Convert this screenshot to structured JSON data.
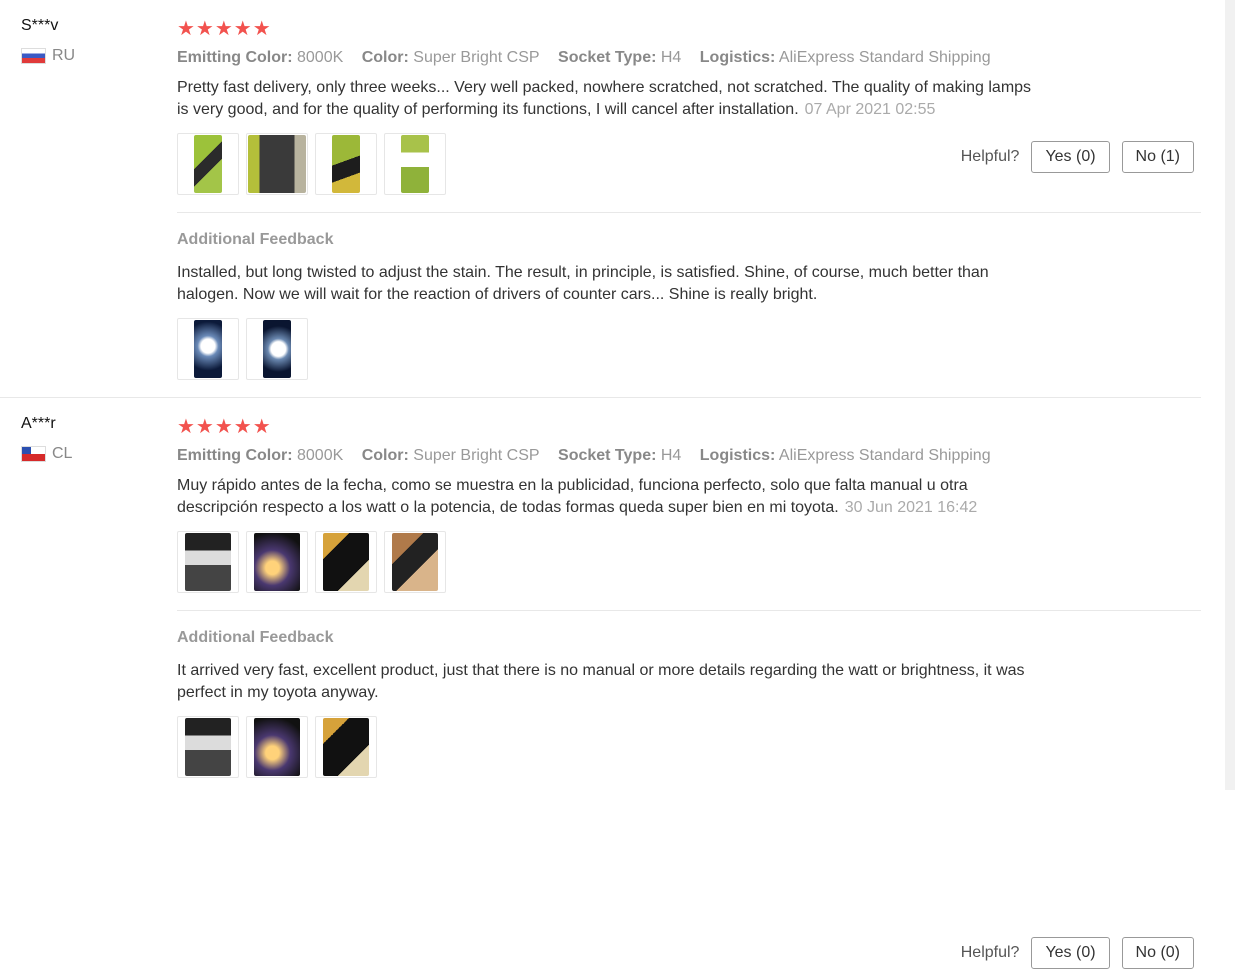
{
  "helpful_label": "Helpful?",
  "additional_feedback_title": "Additional Feedback",
  "reviews": [
    {
      "user": "S***v",
      "country": "RU",
      "stars": "★★★★★",
      "props": [
        {
          "label": "Emitting Color:",
          "value": "8000K"
        },
        {
          "label": "Color:",
          "value": "Super Bright CSP"
        },
        {
          "label": "Socket Type:",
          "value": "H4"
        },
        {
          "label": "Logistics:",
          "value": "AliExpress Standard Shipping"
        }
      ],
      "text": "Pretty fast delivery, only three weeks... Very well packed, nowhere scratched, not scratched. The quality of making lamps is very good, and for the quality of performing its functions, I will cancel after installation.",
      "date": "07 Apr 2021 02:55",
      "yes_label": "Yes (0)",
      "no_label": "No (1)",
      "additional_text": "Installed, but long twisted to adjust the stain. The result, in principle, is satisfied. Shine, of course, much better than halogen. Now we will wait for the reaction of drivers of counter cars... Shine is really bright."
    },
    {
      "user": "A***r",
      "country": "CL",
      "stars": "★★★★★",
      "props": [
        {
          "label": "Emitting Color:",
          "value": "8000K"
        },
        {
          "label": "Color:",
          "value": "Super Bright CSP"
        },
        {
          "label": "Socket Type:",
          "value": "H4"
        },
        {
          "label": "Logistics:",
          "value": "AliExpress Standard Shipping"
        }
      ],
      "text": "Muy rápido antes de la fecha, como se muestra en la publicidad, funciona perfecto, solo que falta manual u otra descripción respecto a los watt o la potencia, de todas formas queda super bien en mi toyota.",
      "date": "30 Jun 2021 16:42",
      "yes_label": "Yes (0)",
      "no_label": "No (0)",
      "additional_text": "It arrived very fast, excellent product, just that there is no manual or more details regarding the watt or brightness, it was perfect in my toyota anyway."
    }
  ]
}
